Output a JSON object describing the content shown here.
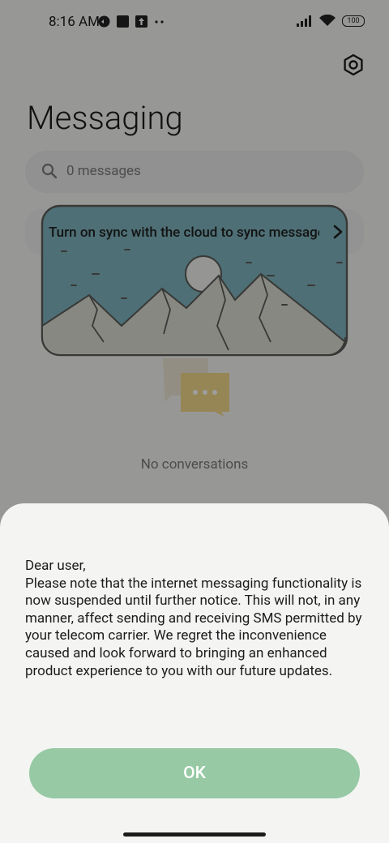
{
  "status_bar": {
    "time": "8:16 AM",
    "battery": "100"
  },
  "header": {
    "title": "Messaging"
  },
  "search": {
    "placeholder": "0 messages"
  },
  "sync_banner": {
    "text": "Turn on sync with the cloud to sync messages"
  },
  "empty_state": {
    "text": "No conversations"
  },
  "dialog": {
    "message": "Dear user,\nPlease note that the internet messaging functionality is now suspended until further notice. This will not, in any manner, affect sending and receiving SMS permitted by your telecom carrier. We regret the inconvenience caused and look forward to bringing an enhanced product experience to you with our future updates.",
    "ok_label": "OK"
  },
  "colors": {
    "ok_button": "#96c9a4",
    "illustration_sky": "#7eb3bd",
    "mountains": "#dcdcd2"
  },
  "icons": [
    "settings-icon",
    "search-icon",
    "chevron-right-icon",
    "wifi-icon",
    "signal-icon",
    "battery-icon"
  ]
}
